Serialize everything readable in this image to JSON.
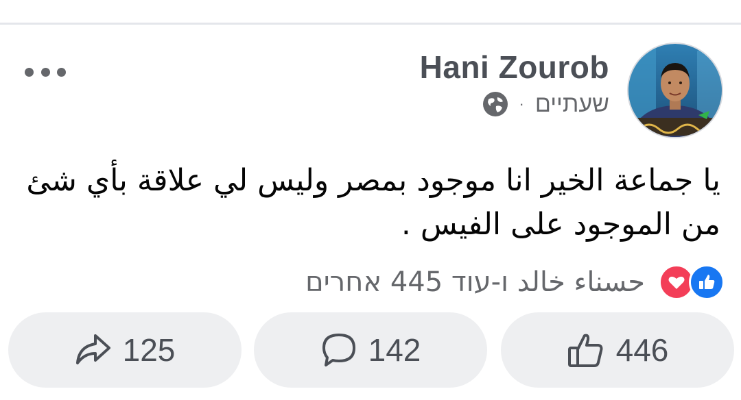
{
  "post": {
    "author": "Hani Zourob",
    "time": "שעתיים",
    "separator": "·",
    "text_line1": "يا جماعة الخير انا موجود بمصر وليس لي علاقة بأي شئ",
    "text_line2": "من الموجود على الفيس ."
  },
  "reactions": {
    "summary": "حسناء خالد ו-עוד 445 אחרים",
    "types": [
      "like-icon",
      "love-icon"
    ],
    "colors": {
      "like": "#1877f2",
      "love": "#f33e58"
    }
  },
  "actions": {
    "share_count": "125",
    "comment_count": "142",
    "like_count": "446"
  },
  "icons": [
    "more-options-icon",
    "globe-icon",
    "share-icon",
    "comment-icon",
    "thumbs-up-icon"
  ]
}
